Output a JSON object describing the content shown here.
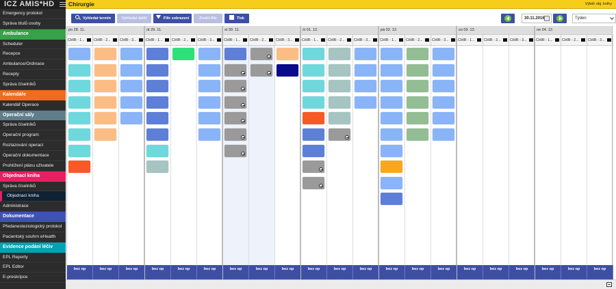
{
  "colors": {
    "ambulance": "#38a049",
    "kalendare": "#ef6c1e",
    "operacni_saly": "#607d8b",
    "objednaci_kniha": "#e91e63",
    "dokumentace": "#3f51b5",
    "evidence": "#00a3b4",
    "toolbar_button": "#3e4fa3",
    "topbar": "#f5cd1a",
    "slot_light_blue": "#8ab4f8",
    "slot_cyan": "#6fd8dc",
    "slot_orange": "#fcbd85",
    "slot_blue": "#5e7fd8",
    "slot_green_bright": "#2ee07a",
    "slot_gray_green": "#a5c4c2",
    "slot_gray": "#9a9a9a",
    "slot_navy": "#0a0a8a",
    "slot_red_orange": "#f85a26",
    "slot_sage": "#93be93",
    "slot_amber": "#f9a81a"
  },
  "app": {
    "logo": "ICZ AMIS*HD",
    "title": "Chirurgie",
    "top_right_link": "Výběr obj. knihy"
  },
  "sidebar": {
    "items": [
      {
        "type": "item",
        "label": "Emergency protokol"
      },
      {
        "type": "item",
        "label": "Správa titulů osoby"
      },
      {
        "type": "header",
        "label": "Ambulance",
        "color": "ambulance"
      },
      {
        "type": "item",
        "label": "Scheduler"
      },
      {
        "type": "item",
        "label": "Recepce"
      },
      {
        "type": "item",
        "label": "Ambulance/Ordinace"
      },
      {
        "type": "item",
        "label": "Recepty"
      },
      {
        "type": "item",
        "label": "Správa číselníků"
      },
      {
        "type": "header",
        "label": "Kalendáře",
        "color": "kalendare"
      },
      {
        "type": "item",
        "label": "Kalendář Operace"
      },
      {
        "type": "header",
        "label": "Operační sály",
        "color": "operacni_saly"
      },
      {
        "type": "item",
        "label": "Správa číselníků"
      },
      {
        "type": "item",
        "label": "Operační program"
      },
      {
        "type": "item",
        "label": "Rozlazování operací"
      },
      {
        "type": "item",
        "label": "Operační dokumentace"
      },
      {
        "type": "item",
        "label": "Prohlížení plánu uživatele"
      },
      {
        "type": "header",
        "label": "Objednací kniha",
        "color": "objednaci_kniha"
      },
      {
        "type": "item",
        "label": "Správa číselníků"
      },
      {
        "type": "item",
        "label": "Objednací kniha",
        "active": true
      },
      {
        "type": "item",
        "label": "Administrace"
      },
      {
        "type": "header",
        "label": "Dokumentace",
        "color": "dokumentace"
      },
      {
        "type": "item",
        "label": "Předanesteziologický protokol"
      },
      {
        "type": "item",
        "label": "Pacientský souhrn eHealth"
      },
      {
        "type": "header",
        "label": "Evidence podání léčiv",
        "color": "evidence"
      },
      {
        "type": "item",
        "label": "EPL Reporty"
      },
      {
        "type": "item",
        "label": "EPL Editor"
      },
      {
        "type": "item",
        "label": "E-preskripce"
      }
    ]
  },
  "toolbar": {
    "find_term": "Vyhledat termín",
    "find_next": "Vyhledat další",
    "filter": "Filtr zobrazení",
    "cancel_filter": "Zrušit filtr",
    "print": "Tisk",
    "date": "30.11.2016",
    "view": "Týden"
  },
  "calendar": {
    "room_labels": [
      "CHIR - 1...",
      "CHIR - 2...",
      "CHIR - 3..."
    ],
    "footer_label": "bez op",
    "days": [
      {
        "label": "po 28. 11.",
        "rooms": [
          {
            "slots": [
              [
                "slot_light_blue",
                0
              ],
              [
                "slot_cyan",
                0
              ],
              [
                "slot_cyan",
                0
              ],
              [
                "slot_cyan",
                0
              ],
              [
                "slot_cyan",
                0
              ],
              [
                "slot_cyan",
                0
              ],
              [
                "slot_cyan",
                0
              ],
              [
                "slot_red_orange",
                0
              ]
            ]
          },
          {
            "slots": [
              [
                "slot_orange",
                0
              ],
              [
                "slot_orange",
                0
              ],
              [
                "slot_orange",
                0
              ],
              [
                "slot_orange",
                0
              ],
              [
                "slot_orange",
                0
              ],
              [
                "slot_orange",
                0
              ]
            ]
          },
          {
            "slots": [
              [
                "slot_light_blue",
                0
              ],
              [
                "slot_light_blue",
                0
              ],
              [
                "slot_light_blue",
                0
              ],
              [
                "slot_light_blue",
                0
              ],
              [
                "slot_light_blue",
                0
              ]
            ]
          }
        ]
      },
      {
        "label": "út 29. 11.",
        "rooms": [
          {
            "slots": [
              [
                "slot_blue",
                0
              ],
              [
                "slot_blue",
                0
              ],
              [
                "slot_blue",
                0
              ],
              [
                "slot_blue",
                0
              ],
              [
                "slot_blue",
                0
              ],
              [
                "slot_blue",
                0
              ],
              [
                "slot_cyan",
                0
              ],
              [
                "slot_gray_green",
                0
              ]
            ]
          },
          {
            "slots": [
              [
                "slot_green_bright",
                0
              ]
            ]
          },
          {
            "slots": [
              [
                "slot_light_blue",
                0
              ],
              [
                "slot_light_blue",
                0
              ],
              [
                "slot_light_blue",
                0
              ],
              [
                "slot_light_blue",
                0
              ],
              [
                "slot_light_blue",
                0
              ],
              [
                "slot_light_blue",
                0
              ]
            ]
          }
        ]
      },
      {
        "label": "st 30. 11.",
        "shaded": true,
        "rooms": [
          {
            "slots": [
              [
                "slot_blue",
                0
              ],
              [
                "slot_gray",
                1
              ],
              [
                "slot_gray",
                1
              ],
              [
                "slot_gray",
                1
              ],
              [
                "slot_gray",
                1
              ],
              [
                "slot_gray",
                1
              ],
              [
                "slot_gray",
                1
              ]
            ]
          },
          {
            "slots": [
              [
                "slot_gray",
                1
              ],
              [
                "slot_gray",
                1
              ]
            ]
          },
          {
            "slots": [
              [
                "slot_orange",
                0
              ],
              [
                "slot_navy",
                0
              ]
            ]
          }
        ]
      },
      {
        "label": "čt 01. 12.",
        "rooms": [
          {
            "slots": [
              [
                "slot_cyan",
                0
              ],
              [
                "slot_cyan",
                0
              ],
              [
                "slot_cyan",
                0
              ],
              [
                "slot_cyan",
                0
              ],
              [
                "slot_red_orange",
                0
              ],
              [
                "slot_blue",
                0
              ],
              [
                "slot_blue",
                0
              ],
              [
                "slot_gray",
                1
              ],
              [
                "slot_gray",
                1
              ]
            ]
          },
          {
            "slots": [
              [
                "slot_gray_green",
                0
              ],
              [
                "slot_gray_green",
                0
              ],
              [
                "slot_gray_green",
                0
              ],
              [
                "slot_gray_green",
                0
              ],
              [
                "slot_gray_green",
                0
              ],
              [
                "slot_gray",
                1
              ]
            ]
          },
          {
            "slots": [
              [
                "slot_light_blue",
                0
              ],
              [
                "slot_light_blue",
                0
              ],
              [
                "slot_light_blue",
                0
              ],
              [
                "slot_light_blue",
                0
              ]
            ]
          }
        ]
      },
      {
        "label": "pá 02. 12.",
        "rooms": [
          {
            "slots": [
              [
                "slot_light_blue",
                0
              ],
              [
                "slot_light_blue",
                0
              ],
              [
                "slot_light_blue",
                0
              ],
              [
                "slot_light_blue",
                0
              ],
              [
                "slot_light_blue",
                0
              ],
              [
                "slot_light_blue",
                0
              ],
              [
                "slot_light_blue",
                0
              ],
              [
                "slot_amber",
                0
              ],
              [
                "slot_light_blue",
                0
              ],
              [
                "slot_blue",
                0
              ]
            ]
          },
          {
            "slots": [
              [
                "slot_sage",
                0
              ],
              [
                "slot_sage",
                0
              ],
              [
                "slot_sage",
                0
              ],
              [
                "slot_sage",
                0
              ],
              [
                "slot_sage",
                0
              ],
              [
                "slot_sage",
                0
              ]
            ]
          },
          {
            "slots": [
              [
                "slot_light_blue",
                0
              ],
              [
                "slot_light_blue",
                0
              ],
              [
                "slot_light_blue",
                0
              ],
              [
                "slot_light_blue",
                0
              ],
              [
                "slot_light_blue",
                0
              ],
              [
                "slot_light_blue",
                0
              ]
            ]
          }
        ]
      },
      {
        "label": "so 03. 12.",
        "rooms": [
          {
            "slots": []
          },
          {
            "slots": []
          },
          {
            "slots": []
          }
        ]
      },
      {
        "label": "ne 04. 12.",
        "rooms": [
          {
            "slots": []
          },
          {
            "slots": []
          },
          {
            "slots": []
          }
        ]
      }
    ]
  }
}
